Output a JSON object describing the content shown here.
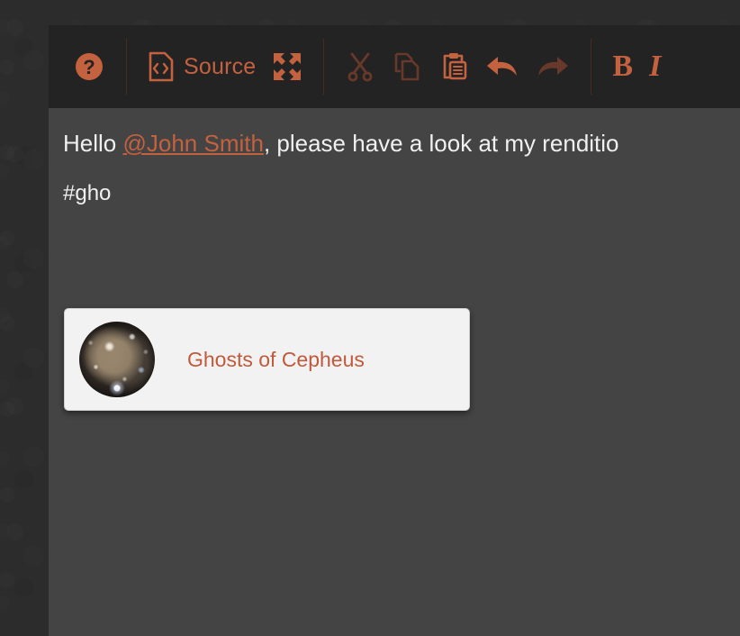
{
  "theme": {
    "accent_color": "#c4613f",
    "toolbar_bg": "#232323",
    "editor_bg": "#444444",
    "page_bg": "#2c2c2c",
    "text_color": "#f0f0f0",
    "dropdown_bg": "#f2f2f2",
    "dropdown_item_color": "#c05a3c",
    "disabled_color": "#68392a"
  },
  "toolbar": {
    "buttons": [
      {
        "name": "help-icon",
        "icon": "question-mark-circle-icon",
        "label": "",
        "enabled": true
      },
      {
        "name": "source-button",
        "icon": "source-code-document-icon",
        "label": "Source",
        "enabled": true
      },
      {
        "name": "maximize-button",
        "icon": "maximize-arrows-icon",
        "label": "",
        "enabled": true
      },
      {
        "name": "cut-button",
        "icon": "scissors-icon",
        "label": "",
        "enabled": false
      },
      {
        "name": "copy-button",
        "icon": "copy-pages-icon",
        "label": "",
        "enabled": false
      },
      {
        "name": "paste-button",
        "icon": "clipboard-paste-icon",
        "label": "",
        "enabled": true
      },
      {
        "name": "undo-button",
        "icon": "undo-arrow-icon",
        "label": "",
        "enabled": true
      },
      {
        "name": "redo-button",
        "icon": "redo-arrow-icon",
        "label": "",
        "enabled": false
      },
      {
        "name": "bold-button",
        "icon": "bold-letter-icon",
        "label": "B",
        "enabled": true
      },
      {
        "name": "italic-button",
        "icon": "italic-letter-icon",
        "label": "I",
        "enabled": true
      }
    ],
    "source_label": "Source",
    "bold_label": "B",
    "italic_label": "I"
  },
  "document": {
    "paragraph": {
      "prefix": "Hello ",
      "mention": "@John Smith",
      "suffix": ", please have a look at my renditio"
    },
    "hashtag_query": "#gho"
  },
  "autocomplete": {
    "items": [
      {
        "label": "Ghosts of Cepheus",
        "thumbnail": "nebula-thumbnail"
      }
    ]
  }
}
